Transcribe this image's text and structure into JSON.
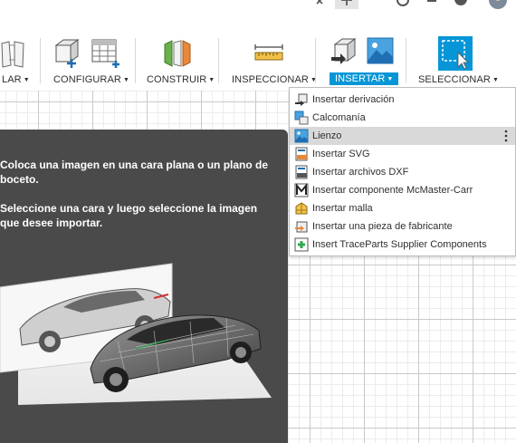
{
  "toolbar": {
    "groups": [
      {
        "label": "LAR"
      },
      {
        "label": "CONFIGURAR"
      },
      {
        "label": "CONSTRUIR"
      },
      {
        "label": "INSPECCIONAR"
      },
      {
        "label": "INSERTAR"
      },
      {
        "label": "SELECCIONAR"
      }
    ],
    "caret": "▼",
    "active_group": "INSERTAR",
    "accent_color": "#0696d7"
  },
  "insert_menu": {
    "items": [
      {
        "label": "Insertar derivación",
        "icon": "derive-icon"
      },
      {
        "label": "Calcomanía",
        "icon": "decal-icon"
      },
      {
        "label": "Lienzo",
        "icon": "canvas-image-icon",
        "highlighted": true
      },
      {
        "label": "Insertar SVG",
        "icon": "svg-file-icon"
      },
      {
        "label": "Insertar archivos DXF",
        "icon": "dxf-file-icon"
      },
      {
        "label": "Insertar componente McMaster-Carr",
        "icon": "mcmaster-icon"
      },
      {
        "label": "Insertar malla",
        "icon": "mesh-icon"
      },
      {
        "label": "Insertar una pieza de fabricante",
        "icon": "manufacturer-part-icon"
      },
      {
        "label": "Insert TraceParts Supplier Components",
        "icon": "traceparts-icon"
      }
    ],
    "more_icon": "vertical-ellipsis-icon"
  },
  "tooltip": {
    "paragraph1": "Coloca una imagen en una cara plana o un plano de boceto.",
    "paragraph2": "Seleccione una cara y luego seleccione la imagen que desee importar."
  }
}
